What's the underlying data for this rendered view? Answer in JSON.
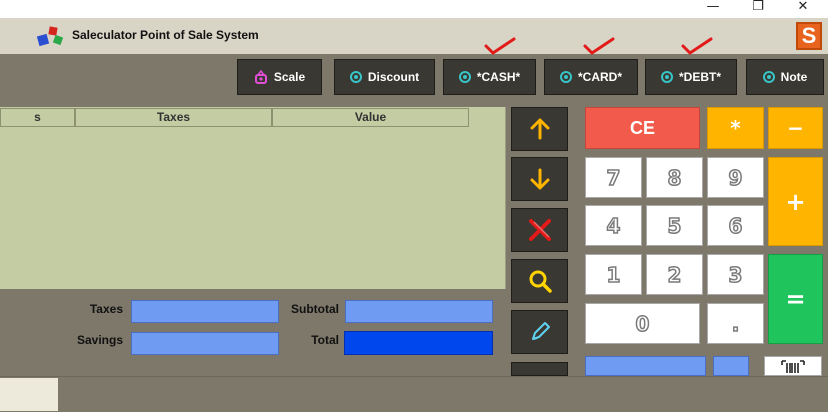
{
  "window": {
    "title": "Saleculator Point of Sale System",
    "controls": {
      "minimize": "—",
      "maximize": "❐",
      "close": "✕"
    },
    "logo_letter": "S"
  },
  "toolbar": {
    "scale": "Scale",
    "discount": "Discount",
    "cash": "*CASH*",
    "card": "*CARD*",
    "debt": "*DEBT*",
    "note": "Note"
  },
  "table": {
    "columns": [
      "s",
      "Taxes",
      "Value"
    ]
  },
  "totals": {
    "taxes_label": "Taxes",
    "savings_label": "Savings",
    "subtotal_label": "Subtotal",
    "total_label": "Total"
  },
  "keypad": {
    "ce": "CE",
    "multiply": "*",
    "minus": "−",
    "plus": "+",
    "equals": "=",
    "k7": "7",
    "k8": "8",
    "k9": "9",
    "k4": "4",
    "k5": "5",
    "k6": "6",
    "k1": "1",
    "k2": "2",
    "k3": "3",
    "k0": "0",
    "dot": "."
  },
  "colors": {
    "toolbar_button": "#3a3832",
    "ce_red": "#f25a4c",
    "operator_orange": "#ffb400",
    "equals_green": "#1fc45c",
    "field_blue": "#6f9bf2",
    "total_blue": "#0047ee",
    "grid_bg": "#c4cca3",
    "check_red": "#e21a1a"
  },
  "icons": {
    "scale": "scale-icon",
    "payment": "radio-target-icon",
    "up": "arrow-up-icon",
    "down": "arrow-down-icon",
    "delete": "red-x-icon",
    "search": "magnifier-icon",
    "edit": "pencil-icon",
    "barcode": "barcode-icon"
  }
}
